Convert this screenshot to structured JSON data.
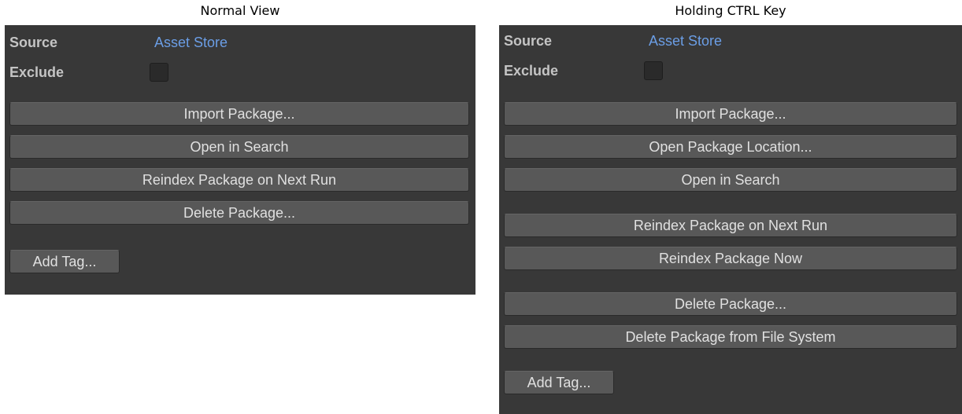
{
  "left": {
    "caption": "Normal View",
    "source_label": "Source",
    "source_value": "Asset Store",
    "exclude_label": "Exclude",
    "buttons": {
      "import": "Import Package...",
      "open_search": "Open in Search",
      "reindex_next": "Reindex Package on Next Run",
      "delete": "Delete Package..."
    },
    "add_tag": "Add Tag..."
  },
  "right": {
    "caption": "Holding CTRL Key",
    "source_label": "Source",
    "source_value": "Asset Store",
    "exclude_label": "Exclude",
    "buttons": {
      "import": "Import Package...",
      "open_location": "Open Package Location...",
      "open_search": "Open in Search",
      "reindex_next": "Reindex Package on Next Run",
      "reindex_now": "Reindex Package Now",
      "delete": "Delete Package...",
      "delete_fs": "Delete Package from File System"
    },
    "add_tag": "Add Tag..."
  },
  "colors": {
    "panel_bg": "#383838",
    "button_bg": "#585858",
    "link_blue": "#6b9ee6",
    "label_text": "#c4c4c4"
  }
}
